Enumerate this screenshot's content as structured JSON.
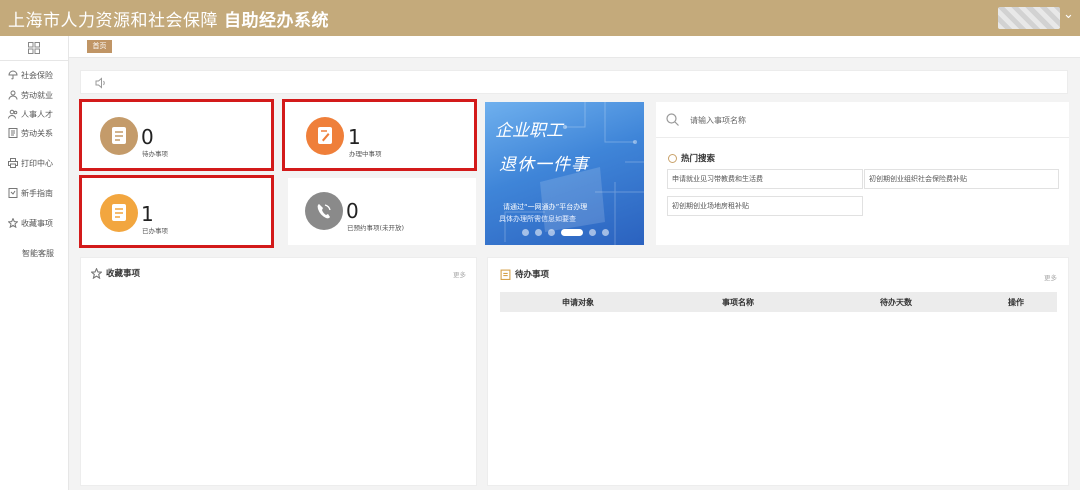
{
  "header": {
    "title": "上海市人力资源和社会保障",
    "title_strong": "自助经办系统",
    "user_chevron": "⌄"
  },
  "sidebar": {
    "items": [
      {
        "label": "社会保险"
      },
      {
        "label": "劳动就业"
      },
      {
        "label": "人事人才"
      },
      {
        "label": "劳动关系"
      },
      {
        "label": "打印中心"
      },
      {
        "label": "新手指南"
      },
      {
        "label": "收藏事项"
      },
      {
        "label": "智能客服"
      }
    ]
  },
  "tabs": {
    "home": "首页"
  },
  "stats": [
    {
      "count": "0",
      "label": "待办事项",
      "color": "#c49b6a"
    },
    {
      "count": "1",
      "label": "办理中事项",
      "color": "#ef7f3a"
    },
    {
      "count": "1",
      "label": "已办事项",
      "color": "#f2a63f"
    },
    {
      "count": "0",
      "label": "已预约事项(未开放)",
      "color": "#8a8a8a"
    }
  ],
  "banner": {
    "title1": "企业职工",
    "title2": "退休一件事",
    "line1": "请通过“一网通办”平台办理",
    "line2": "具体办理所需信息如要查"
  },
  "search": {
    "placeholder": "请输入事项名称",
    "hot_title": "热门搜索",
    "hot_items": [
      "申请就业见习带教费和生活费",
      "初创期创业组织社会保险费补贴",
      "初创期创业场地房租补贴"
    ]
  },
  "favorites": {
    "title": "收藏事项",
    "more": "更多"
  },
  "todo": {
    "title": "待办事项",
    "more": "更多",
    "columns": [
      "申请对象",
      "事项名称",
      "待办天数",
      "操作"
    ]
  },
  "colors": {
    "header_bg": "#c4aa7b",
    "highlight_border": "#d31a1a",
    "home_tab": "#c09565"
  }
}
